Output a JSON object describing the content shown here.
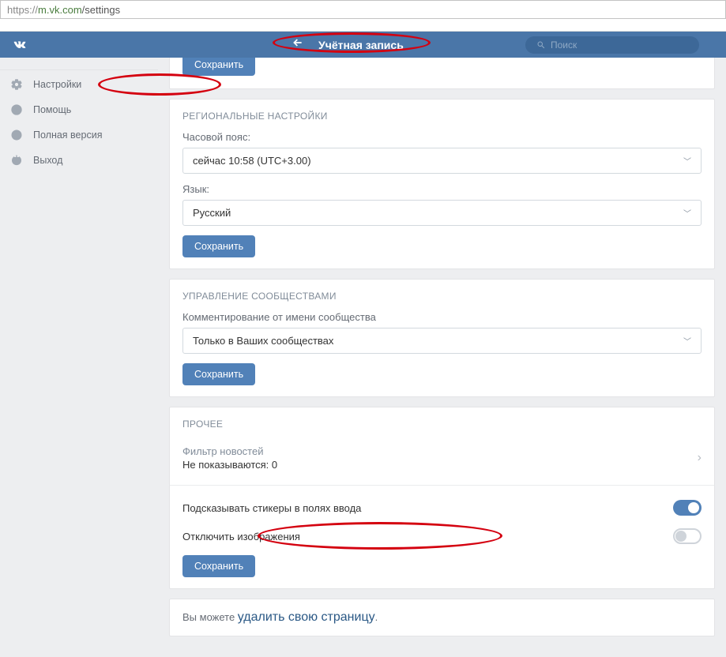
{
  "url": {
    "protocol": "https://",
    "domain": "m.vk.com",
    "path": "/settings"
  },
  "header": {
    "title": "Учётная запись",
    "search_placeholder": "Поиск"
  },
  "sidebar": {
    "items": [
      {
        "label": "Настройки",
        "icon": "gear"
      },
      {
        "label": "Помощь",
        "icon": "help"
      },
      {
        "label": "Полная версия",
        "icon": "globe"
      },
      {
        "label": "Выход",
        "icon": "power"
      }
    ]
  },
  "sections": {
    "regional": {
      "title": "РЕГИОНАЛЬНЫЕ НАСТРОЙКИ",
      "tz_label": "Часовой пояс:",
      "tz_value": "сейчас 10:58 (UTC+3.00)",
      "lang_label": "Язык:",
      "lang_value": "Русский",
      "save": "Сохранить"
    },
    "communities": {
      "title": "УПРАВЛЕНИЕ СООБЩЕСТВАМИ",
      "comment_label": "Комментирование от имени сообщества",
      "comment_value": "Только в Ваших сообществах",
      "save": "Сохранить"
    },
    "other": {
      "title": "ПРОЧЕЕ",
      "filter_label": "Фильтр новостей",
      "filter_value": "Не показываются: 0",
      "stickers_label": "Подсказывать стикеры в полях ввода",
      "stickers_on": true,
      "images_label": "Отключить изображения",
      "images_on": false,
      "save": "Сохранить"
    },
    "delete": {
      "prefix": "Вы можете ",
      "link": "удалить свою страницу",
      "suffix": "."
    }
  },
  "cut_button": "Сохранить"
}
